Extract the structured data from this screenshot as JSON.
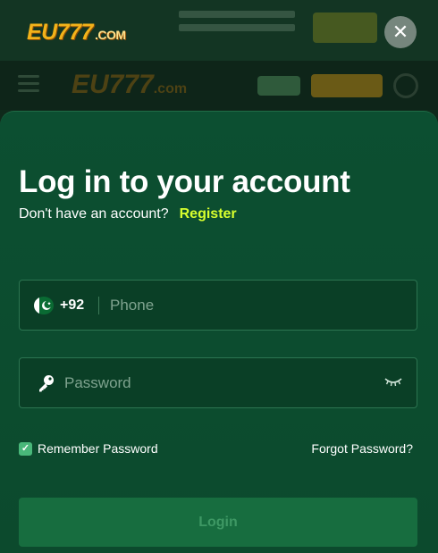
{
  "header": {
    "logo_text": "EU777",
    "logo_suffix": ".COM",
    "close_label": "✕"
  },
  "background_nav": {
    "logo_text": "EU777",
    "logo_suffix": ".com"
  },
  "login": {
    "title": "Log in to your account",
    "no_account_text": "Don't have an account?",
    "register_label": "Register",
    "phone": {
      "country_code": "+92",
      "placeholder": "Phone",
      "value": ""
    },
    "password": {
      "placeholder": "Password",
      "value": ""
    },
    "remember_label": "Remember Password",
    "remember_checked": true,
    "forgot_label": "Forgot Password?",
    "submit_label": "Login"
  },
  "icons": {
    "flag": "pakistan-flag-icon",
    "key": "key-icon",
    "eye": "eye-closed-icon",
    "close": "close-icon",
    "check": "checkmark-icon",
    "menu": "menu-icon"
  },
  "colors": {
    "modal_bg": "#0c4f31",
    "register_accent": "#d8ff2e",
    "checkbox": "#49b87a",
    "login_button": "#176d3f"
  }
}
